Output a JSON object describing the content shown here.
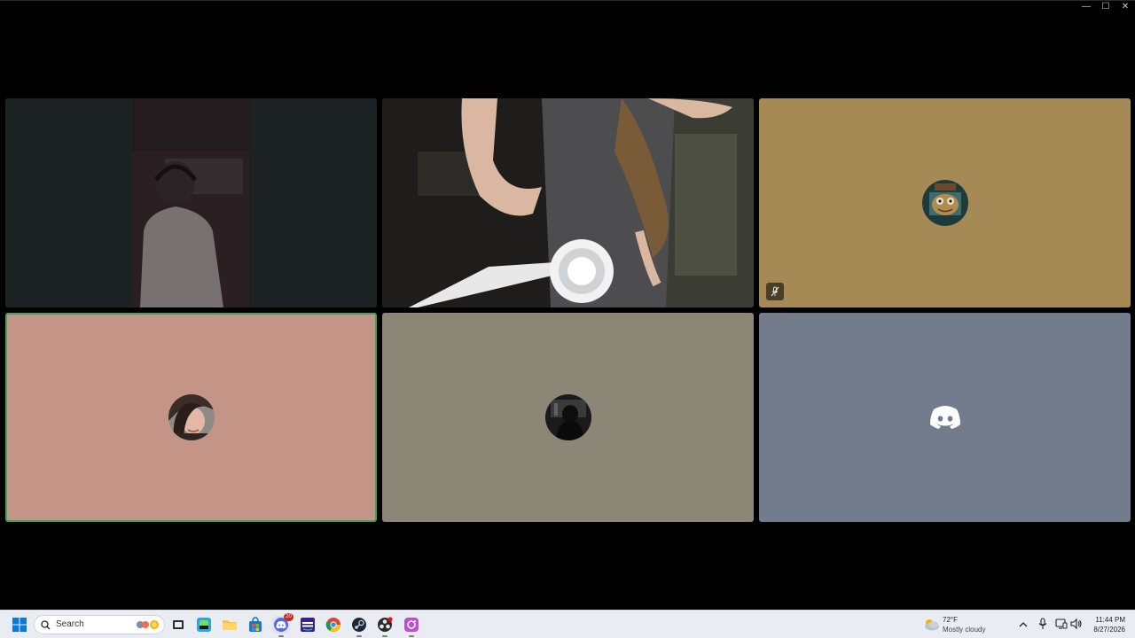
{
  "window": {
    "controls": {
      "minimize": "—",
      "maximize": "☐",
      "close": "✕"
    }
  },
  "tiles": [
    {
      "kind": "video",
      "description_icon": "camera-feed-1"
    },
    {
      "kind": "video",
      "description_icon": "camera-feed-2"
    },
    {
      "kind": "avatar",
      "bg": "#a68a55",
      "muted": true
    },
    {
      "kind": "avatar",
      "bg": "#c49587",
      "speaking": true,
      "border": "#3ba55d"
    },
    {
      "kind": "avatar",
      "bg": "#8c8677"
    },
    {
      "kind": "avatar",
      "bg": "#727c8d",
      "icon": "discord-logo-icon"
    }
  ],
  "taskbar": {
    "search_placeholder": "Search",
    "weather": {
      "temp": "72°F",
      "condition": "Mostly cloudy"
    },
    "clock": {
      "time": "11:44 PM",
      "date": "8/27/2026"
    },
    "discord_badge": "20"
  }
}
